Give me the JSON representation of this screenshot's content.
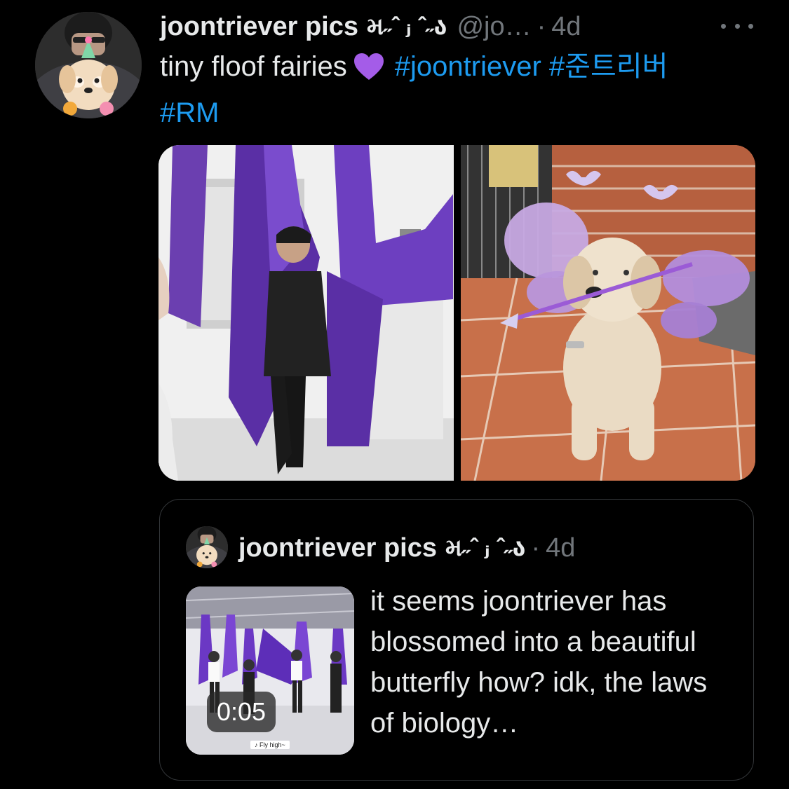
{
  "tweet": {
    "display_name": "joontriever pics",
    "kaomoji": "મ˶ˆ ⱼ ˆ˶ა",
    "handle": "@jo…",
    "separator": "·",
    "time": "4d",
    "text_before": "tiny floof fairies",
    "heart_emoji": "purple-heart",
    "hashtags": [
      "#joontriever",
      "#준트리버",
      "#RM"
    ],
    "more_icon": "more-horizontal-icon"
  },
  "media": {
    "left_image": "person in purple aerial silk hammock",
    "right_image": "golden retriever puppy wearing purple fairy wings"
  },
  "quote": {
    "display_name": "joontriever pics",
    "kaomoji": "મ˶ˆ ⱼ ˆ˶ა",
    "separator": "·",
    "time": "4d",
    "video_duration": "0:05",
    "thumb_caption": "♪ Fly high~",
    "text": "it seems joontriever has blossomed into a beautiful butterfly how? idk, the laws of biology…"
  },
  "colors": {
    "background": "#000000",
    "text": "#e7e9ea",
    "secondary": "#71767b",
    "link": "#1d9bf0",
    "border": "#333639",
    "heart": "#a45ce8"
  }
}
